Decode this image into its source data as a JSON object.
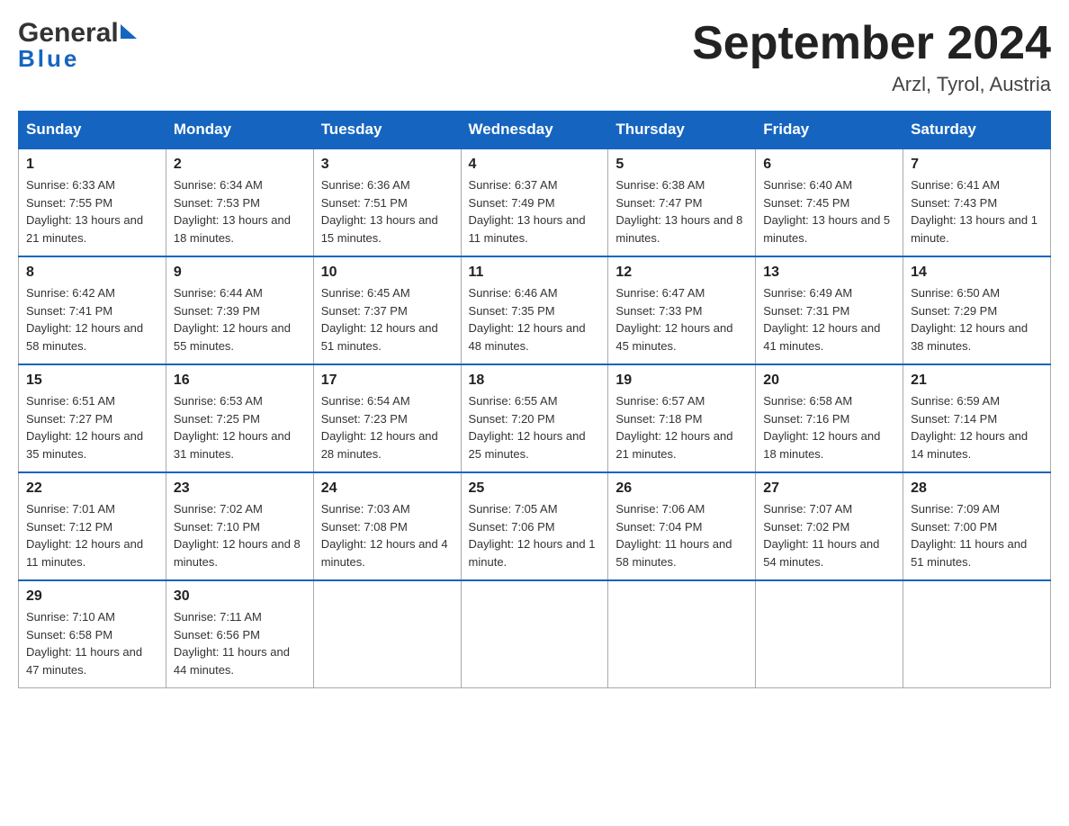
{
  "header": {
    "logo_general": "General",
    "logo_blue": "Blue",
    "month_title": "September 2024",
    "location": "Arzl, Tyrol, Austria"
  },
  "weekdays": [
    "Sunday",
    "Monday",
    "Tuesday",
    "Wednesday",
    "Thursday",
    "Friday",
    "Saturday"
  ],
  "weeks": [
    [
      {
        "day": "1",
        "sunrise": "6:33 AM",
        "sunset": "7:55 PM",
        "daylight": "13 hours and 21 minutes."
      },
      {
        "day": "2",
        "sunrise": "6:34 AM",
        "sunset": "7:53 PM",
        "daylight": "13 hours and 18 minutes."
      },
      {
        "day": "3",
        "sunrise": "6:36 AM",
        "sunset": "7:51 PM",
        "daylight": "13 hours and 15 minutes."
      },
      {
        "day": "4",
        "sunrise": "6:37 AM",
        "sunset": "7:49 PM",
        "daylight": "13 hours and 11 minutes."
      },
      {
        "day": "5",
        "sunrise": "6:38 AM",
        "sunset": "7:47 PM",
        "daylight": "13 hours and 8 minutes."
      },
      {
        "day": "6",
        "sunrise": "6:40 AM",
        "sunset": "7:45 PM",
        "daylight": "13 hours and 5 minutes."
      },
      {
        "day": "7",
        "sunrise": "6:41 AM",
        "sunset": "7:43 PM",
        "daylight": "13 hours and 1 minute."
      }
    ],
    [
      {
        "day": "8",
        "sunrise": "6:42 AM",
        "sunset": "7:41 PM",
        "daylight": "12 hours and 58 minutes."
      },
      {
        "day": "9",
        "sunrise": "6:44 AM",
        "sunset": "7:39 PM",
        "daylight": "12 hours and 55 minutes."
      },
      {
        "day": "10",
        "sunrise": "6:45 AM",
        "sunset": "7:37 PM",
        "daylight": "12 hours and 51 minutes."
      },
      {
        "day": "11",
        "sunrise": "6:46 AM",
        "sunset": "7:35 PM",
        "daylight": "12 hours and 48 minutes."
      },
      {
        "day": "12",
        "sunrise": "6:47 AM",
        "sunset": "7:33 PM",
        "daylight": "12 hours and 45 minutes."
      },
      {
        "day": "13",
        "sunrise": "6:49 AM",
        "sunset": "7:31 PM",
        "daylight": "12 hours and 41 minutes."
      },
      {
        "day": "14",
        "sunrise": "6:50 AM",
        "sunset": "7:29 PM",
        "daylight": "12 hours and 38 minutes."
      }
    ],
    [
      {
        "day": "15",
        "sunrise": "6:51 AM",
        "sunset": "7:27 PM",
        "daylight": "12 hours and 35 minutes."
      },
      {
        "day": "16",
        "sunrise": "6:53 AM",
        "sunset": "7:25 PM",
        "daylight": "12 hours and 31 minutes."
      },
      {
        "day": "17",
        "sunrise": "6:54 AM",
        "sunset": "7:23 PM",
        "daylight": "12 hours and 28 minutes."
      },
      {
        "day": "18",
        "sunrise": "6:55 AM",
        "sunset": "7:20 PM",
        "daylight": "12 hours and 25 minutes."
      },
      {
        "day": "19",
        "sunrise": "6:57 AM",
        "sunset": "7:18 PM",
        "daylight": "12 hours and 21 minutes."
      },
      {
        "day": "20",
        "sunrise": "6:58 AM",
        "sunset": "7:16 PM",
        "daylight": "12 hours and 18 minutes."
      },
      {
        "day": "21",
        "sunrise": "6:59 AM",
        "sunset": "7:14 PM",
        "daylight": "12 hours and 14 minutes."
      }
    ],
    [
      {
        "day": "22",
        "sunrise": "7:01 AM",
        "sunset": "7:12 PM",
        "daylight": "12 hours and 11 minutes."
      },
      {
        "day": "23",
        "sunrise": "7:02 AM",
        "sunset": "7:10 PM",
        "daylight": "12 hours and 8 minutes."
      },
      {
        "day": "24",
        "sunrise": "7:03 AM",
        "sunset": "7:08 PM",
        "daylight": "12 hours and 4 minutes."
      },
      {
        "day": "25",
        "sunrise": "7:05 AM",
        "sunset": "7:06 PM",
        "daylight": "12 hours and 1 minute."
      },
      {
        "day": "26",
        "sunrise": "7:06 AM",
        "sunset": "7:04 PM",
        "daylight": "11 hours and 58 minutes."
      },
      {
        "day": "27",
        "sunrise": "7:07 AM",
        "sunset": "7:02 PM",
        "daylight": "11 hours and 54 minutes."
      },
      {
        "day": "28",
        "sunrise": "7:09 AM",
        "sunset": "7:00 PM",
        "daylight": "11 hours and 51 minutes."
      }
    ],
    [
      {
        "day": "29",
        "sunrise": "7:10 AM",
        "sunset": "6:58 PM",
        "daylight": "11 hours and 47 minutes."
      },
      {
        "day": "30",
        "sunrise": "7:11 AM",
        "sunset": "6:56 PM",
        "daylight": "11 hours and 44 minutes."
      },
      null,
      null,
      null,
      null,
      null
    ]
  ],
  "labels": {
    "sunrise": "Sunrise:",
    "sunset": "Sunset:",
    "daylight": "Daylight:"
  }
}
